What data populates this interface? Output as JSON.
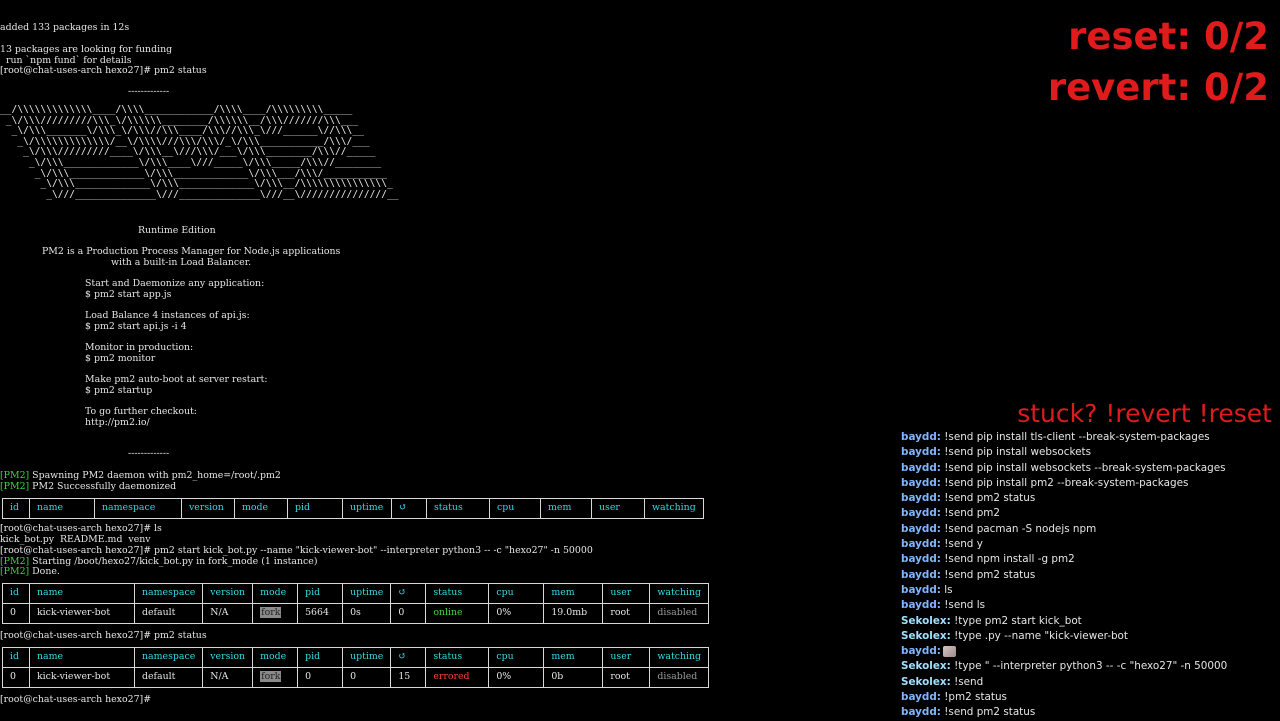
{
  "terminal": {
    "lines_top": [
      "added 133 packages in 12s",
      "",
      "13 packages are looking for funding",
      "  run `npm fund` for details",
      "[root@chat-uses-arch hexo27]# pm2 status"
    ],
    "banner_rule_top": "-------------",
    "logo_ascii": [
      "__/\\\\\\\\\\\\\\\\\\\\\\\\\\____/\\\\\\\\____________/\\\\\\\\____/\\\\\\\\\\\\\\\\\\_____",
      " _\\/\\\\\\/////////\\\\\\_\\/\\\\\\\\\\\\________/\\\\\\\\\\\\__/\\\\\\///////\\\\\\___",
      "  _\\/\\\\\\_______\\/\\\\\\_\\/\\\\\\//\\\\\\____/\\\\\\//\\\\\\_\\///______\\//\\\\\\__",
      "   _\\/\\\\\\\\\\\\\\\\\\\\\\\\\\/__\\/\\\\\\\\///\\\\\\/\\\\\\/_\\/\\\\\\___________/\\\\\\/___",
      "    _\\/\\\\\\/////////____\\/\\\\\\__\\///\\\\\\/___\\/\\\\\\________/\\\\\\//_____",
      "     _\\/\\\\\\_____________\\/\\\\\\____\\///_____\\/\\\\\\_____/\\\\\\//________",
      "      _\\/\\\\\\_____________\\/\\\\\\_____________\\/\\\\\\___/\\\\\\/___________",
      "       _\\/\\\\\\_____________\\/\\\\\\_____________\\/\\\\\\__/\\\\\\\\\\\\\\\\\\\\\\\\\\\\\\_",
      "        _\\///______________\\///______________\\///__\\///////////////__"
    ],
    "runtime_edition": "Runtime Edition",
    "tagline_1": "PM2 is a Production Process Manager for Node.js applications",
    "tagline_2": "with a built-in Load Balancer.",
    "help": [
      "Start and Daemonize any application:",
      "$ pm2 start app.js",
      "",
      "Load Balance 4 instances of api.js:",
      "$ pm2 start api.js -i 4",
      "",
      "Monitor in production:",
      "$ pm2 monitor",
      "",
      "Make pm2 auto-boot at server restart:",
      "$ pm2 startup",
      "",
      "To go further checkout:",
      "http://pm2.io/"
    ],
    "banner_rule_bottom": "-------------",
    "pm2_tag": "[PM2]",
    "spawn_msg": " Spawning PM2 daemon with pm2_home=/root/.pm2",
    "daemon_msg": " PM2 Successfully daemonized",
    "prompt_ls": "[root@chat-uses-arch hexo27]# ls",
    "ls_output": "kick_bot.py  README.md  venv",
    "prompt_start": "[root@chat-uses-arch hexo27]# pm2 start kick_bot.py --name \"kick-viewer-bot\" --interpreter python3 -- -c \"hexo27\" -n 50000",
    "starting_msg": " Starting /boot/hexo27/kick_bot.py in fork_mode (1 instance)",
    "done_msg": " Done.",
    "prompt_status": "[root@chat-uses-arch hexo27]# pm2 status",
    "prompt_final": "[root@chat-uses-arch hexo27]#",
    "table_headers": [
      "id",
      "name",
      "namespace",
      "version",
      "mode",
      "pid",
      "uptime",
      "↺",
      "status",
      "cpu",
      "mem",
      "user",
      "watching"
    ],
    "table2_row": {
      "id": "0",
      "name": "kick-viewer-bot",
      "namespace": "default",
      "version": "N/A",
      "mode": "fork",
      "pid": "5664",
      "uptime": "0s",
      "restarts": "0",
      "status": "online",
      "cpu": "0%",
      "mem": "19.0mb",
      "user": "root",
      "watching": "disabled"
    },
    "table3_row": {
      "id": "0",
      "name": "kick-viewer-bot",
      "namespace": "default",
      "version": "N/A",
      "mode": "fork",
      "pid": "0",
      "uptime": "0",
      "restarts": "15",
      "status": "errored",
      "cpu": "0%",
      "mem": "0b",
      "user": "root",
      "watching": "disabled"
    }
  },
  "overlay": {
    "reset": "reset: 0/2",
    "revert": "revert: 0/2",
    "stuck": "stuck? !revert !reset"
  },
  "chat": [
    {
      "user": "baydd:",
      "text": " !send pip install tls-client --break-system-packages",
      "color": "baydd"
    },
    {
      "user": "baydd:",
      "text": " !send pip install websockets",
      "color": "baydd"
    },
    {
      "user": "baydd:",
      "text": " !send pip install websockets --break-system-packages",
      "color": "baydd"
    },
    {
      "user": "baydd:",
      "text": " !send pip install pm2 --break-system-packages",
      "color": "baydd"
    },
    {
      "user": "baydd:",
      "text": " !send pm2 status",
      "color": "baydd"
    },
    {
      "user": "baydd:",
      "text": " !send pm2",
      "color": "baydd"
    },
    {
      "user": "baydd:",
      "text": " !send pacman -S nodejs npm",
      "color": "baydd"
    },
    {
      "user": "baydd:",
      "text": " !send y",
      "color": "baydd"
    },
    {
      "user": "baydd:",
      "text": " !send npm install -g pm2",
      "color": "baydd"
    },
    {
      "user": "baydd:",
      "text": " !send pm2 status",
      "color": "baydd"
    },
    {
      "user": "baydd:",
      "text": " ls",
      "color": "baydd"
    },
    {
      "user": "baydd:",
      "text": " !send ls",
      "color": "baydd"
    },
    {
      "user": "Sekolex:",
      "text": " !type pm2 start kick_bot",
      "color": "sekolex"
    },
    {
      "user": "Sekolex:",
      "text": " !type .py --name \"kick-viewer-bot",
      "color": "sekolex"
    },
    {
      "user": "baydd:",
      "text": "",
      "color": "baydd",
      "emote": "emote-icon"
    },
    {
      "user": "Sekolex:",
      "text": " !type \" --interpreter python3 -- -c \"hexo27\" -n 50000",
      "color": "sekolex"
    },
    {
      "user": "Sekolex:",
      "text": " !send",
      "color": "sekolex"
    },
    {
      "user": "baydd:",
      "text": " !pm2 status",
      "color": "baydd"
    },
    {
      "user": "baydd:",
      "text": " !send pm2 status",
      "color": "baydd"
    }
  ]
}
